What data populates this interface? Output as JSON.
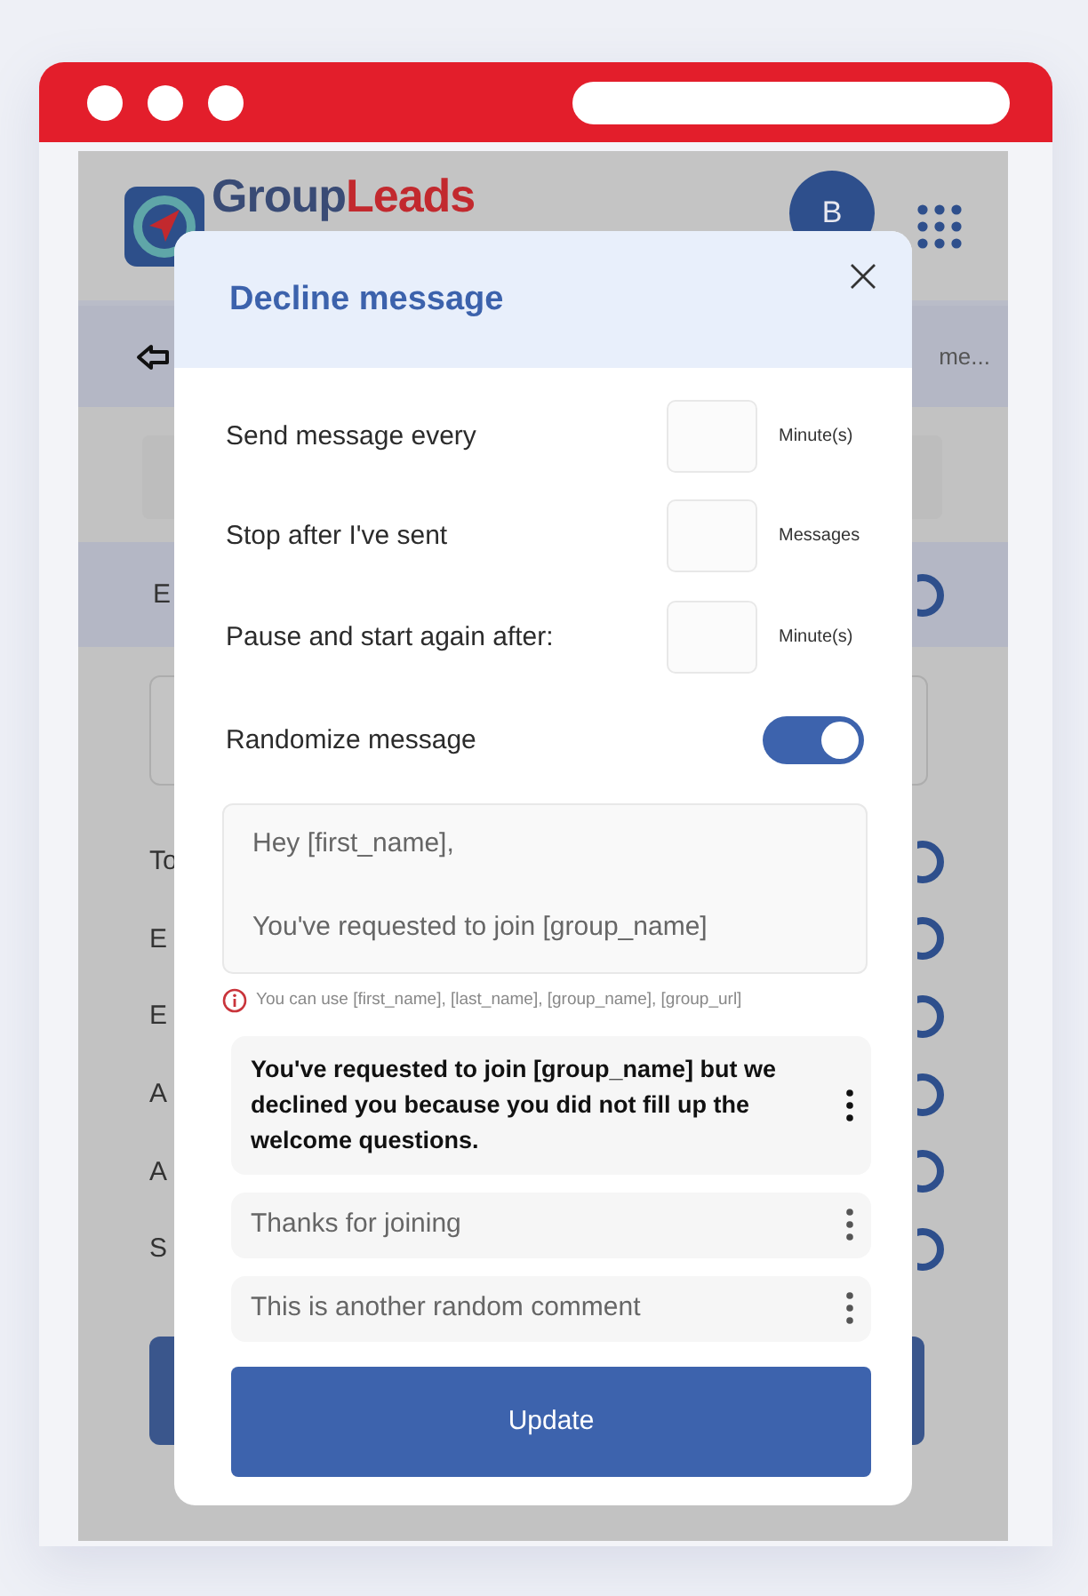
{
  "app": {
    "logo": {
      "first": "Group",
      "second": "Leads"
    },
    "avatar": "B",
    "subheader": {
      "trailing": "me..."
    },
    "section_header": {
      "label": "E"
    },
    "rows": [
      {
        "label": "To"
      },
      {
        "label": "E"
      },
      {
        "label": "E"
      },
      {
        "label": "A"
      },
      {
        "label": "A"
      },
      {
        "label": "S"
      }
    ]
  },
  "dialog": {
    "title": "Decline message",
    "settings": [
      {
        "label": "Send message every",
        "unit": "Minute(s)"
      },
      {
        "label": "Stop after I've sent",
        "unit": "Messages"
      },
      {
        "label": "Pause and start again after:",
        "unit": "Minute(s)"
      }
    ],
    "randomize": {
      "label": "Randomize message",
      "on": true
    },
    "message": {
      "value": "Hey [first_name],\n\nYou've requested to join [group_name]"
    },
    "hint": "You can use [first_name], [last_name], [group_name], [group_url]",
    "messages": [
      {
        "text": "You've requested to join [group_name] but we declined you because you did not fill up the welcome questions.",
        "selected": true
      },
      {
        "text": "Thanks for joining",
        "selected": false
      },
      {
        "text": "This is another random comment",
        "selected": false
      }
    ],
    "button": "Update"
  }
}
